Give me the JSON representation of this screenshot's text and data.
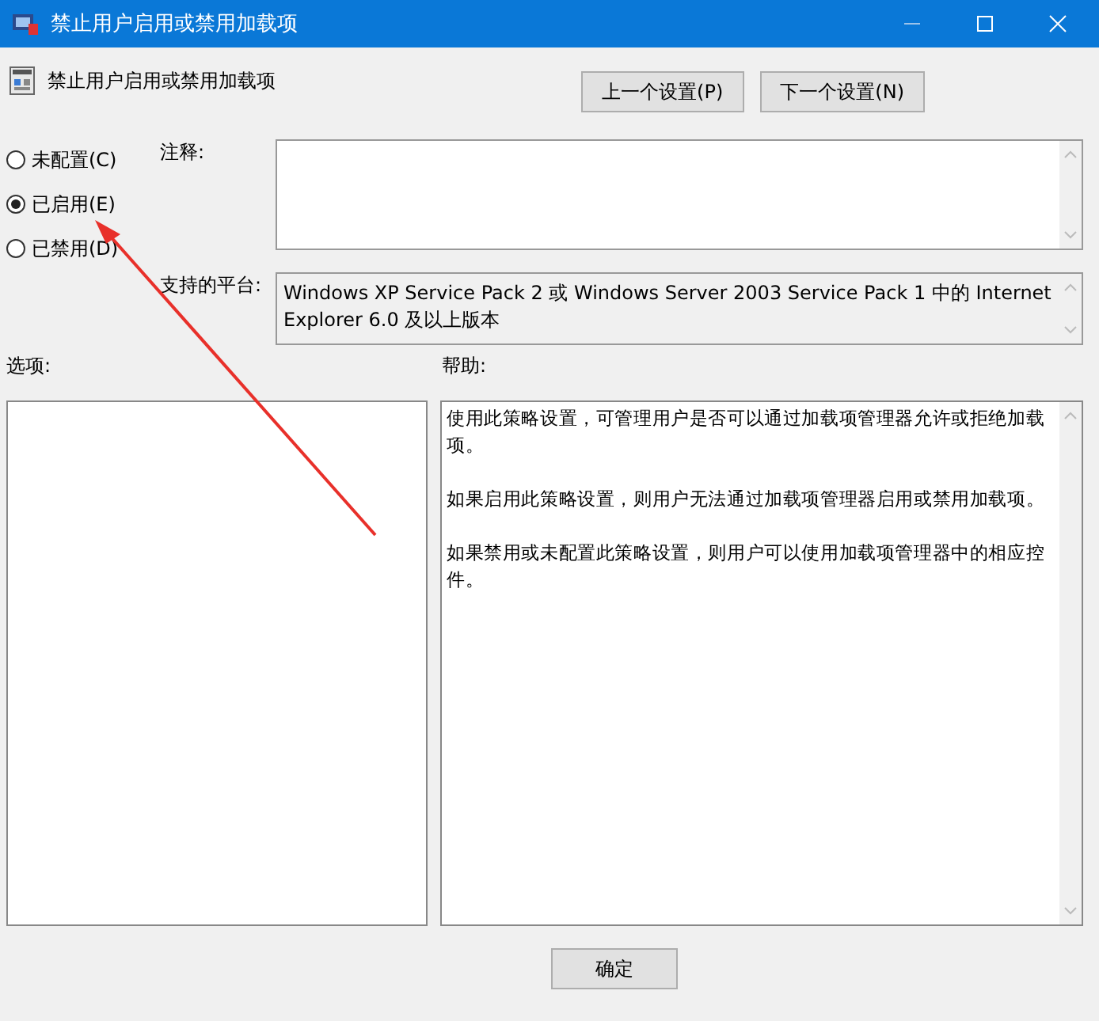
{
  "window": {
    "title": "禁止用户启用或禁用加载项"
  },
  "policy_title": "禁止用户启用或禁用加载项",
  "nav_buttons": [
    "上一个设置(P)",
    "下一个设置(N)"
  ],
  "states": [
    {
      "label": "未配置(C)",
      "selected": false
    },
    {
      "label": "已启用(E)",
      "selected": true
    },
    {
      "label": "已禁用(D)",
      "selected": false
    }
  ],
  "comment": {
    "label": "注释:"
  },
  "platform": {
    "label": "支持的平台:",
    "value": "Windows XP Service Pack 2 或 Windows Server 2003 Service Pack 1 中的 Internet Explorer 6.0 及以上版本"
  },
  "options_label": "选项:",
  "help_label": "帮助:",
  "help_paragraphs": [
    "使用此策略设置，可管理用户是否可以通过加载项管理器允许或拒绝加载项。",
    "如果启用此策略设置，则用户无法通过加载项管理器启用或禁用加载项。",
    "如果禁用或未配置此策略设置，则用户可以使用加载项管理器中的相应控件。"
  ],
  "buttons": [
    "确定"
  ]
}
